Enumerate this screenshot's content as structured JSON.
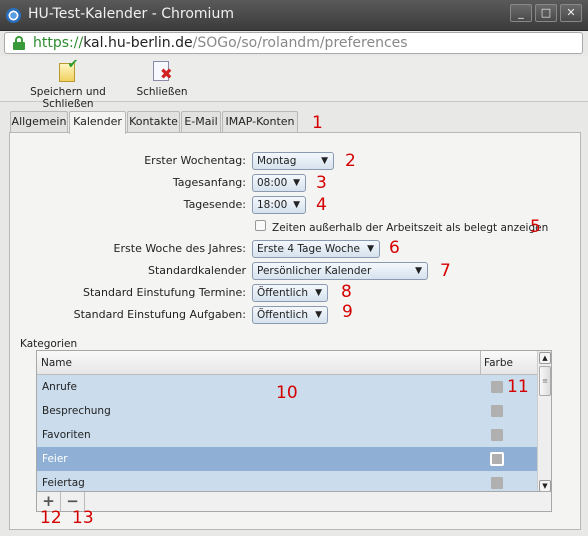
{
  "window": {
    "title": "HU-Test-Kalender - Chromium",
    "buttons": {
      "minimize": "_",
      "maximize": "□",
      "close": "✕"
    }
  },
  "url": {
    "scheme": "https://",
    "host": "kal.hu-berlin.de",
    "path": "/SOGo/so/rolandm/preferences"
  },
  "toolbar": {
    "save_label": "Speichern und Schließen",
    "close_label": "Schließen"
  },
  "tabs": [
    {
      "label": "Allgemein"
    },
    {
      "label": "Kalender",
      "active": true
    },
    {
      "label": "Kontakte"
    },
    {
      "label": "E-Mail"
    },
    {
      "label": "IMAP-Konten"
    }
  ],
  "form": {
    "first_weekday": {
      "label": "Erster Wochentag:",
      "value": "Montag"
    },
    "day_start": {
      "label": "Tagesanfang:",
      "value": "08:00"
    },
    "day_end": {
      "label": "Tagesende:",
      "value": "18:00"
    },
    "busy_outside": {
      "label": "Zeiten außerhalb der Arbeitszeit als belegt anzeigen",
      "checked": false
    },
    "first_week": {
      "label": "Erste Woche des Jahres:",
      "value": "Erste 4 Tage Woche"
    },
    "default_calendar": {
      "label": "Standardkalender",
      "value": "Persönlicher Kalender"
    },
    "event_class": {
      "label": "Standard Einstufung Termine:",
      "value": "Öffentlich"
    },
    "task_class": {
      "label": "Standard Einstufung Aufgaben:",
      "value": "Öffentlich"
    },
    "caret": "▼"
  },
  "categories": {
    "title": "Kategorien",
    "col_name": "Name",
    "col_color": "Farbe",
    "rows": [
      {
        "name": "Anrufe"
      },
      {
        "name": "Besprechung"
      },
      {
        "name": "Favoriten"
      },
      {
        "name": "Feier",
        "selected": true
      },
      {
        "name": "Feiertag"
      }
    ],
    "add_label": "+",
    "remove_label": "−",
    "scroll_up": "▲",
    "scroll_down": "▼",
    "scroll_grip": "≡"
  },
  "annotations": {
    "n1": "1",
    "n2": "2",
    "n3": "3",
    "n4": "4",
    "n5": "5",
    "n6": "6",
    "n7": "7",
    "n8": "8",
    "n9": "9",
    "n10": "10",
    "n11": "11",
    "n12": "12",
    "n13": "13"
  },
  "colors": {
    "annotation": "#d40000",
    "selected_row": "#8fb0d4",
    "list_bg": "#cbdcec"
  }
}
